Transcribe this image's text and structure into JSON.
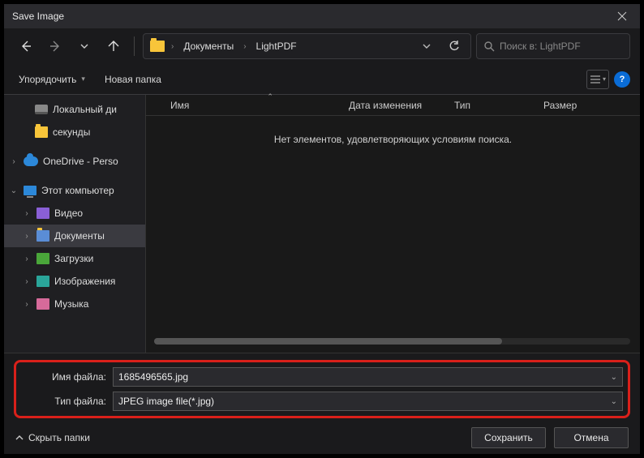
{
  "title": "Save Image",
  "breadcrumbs": {
    "part1": "Документы",
    "part2": "LightPDF"
  },
  "search": {
    "placeholder": "Поиск в: LightPDF"
  },
  "toolbar": {
    "organize": "Упорядочить",
    "newfolder": "Новая папка"
  },
  "columns": {
    "name": "Имя",
    "date": "Дата изменения",
    "type": "Тип",
    "size": "Размер"
  },
  "empty_message": "Нет элементов, удовлетворяющих условиям поиска.",
  "tree": {
    "local_disk": "Локальный ди",
    "seconds": "секунды",
    "onedrive": "OneDrive - Perso",
    "this_pc": "Этот компьютер",
    "videos": "Видео",
    "documents": "Документы",
    "downloads": "Загрузки",
    "pictures": "Изображения",
    "music": "Музыка"
  },
  "fields": {
    "filename_label": "Имя файла:",
    "filename_value": "1685496565.jpg",
    "filetype_label": "Тип файла:",
    "filetype_value": "JPEG image file(*.jpg)"
  },
  "footer": {
    "hide_folders": "Скрыть папки",
    "save": "Сохранить",
    "cancel": "Отмена"
  }
}
